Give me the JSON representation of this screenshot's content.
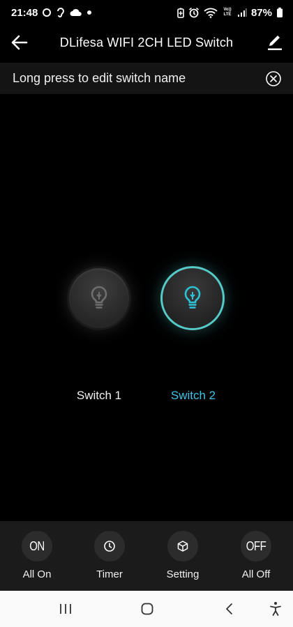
{
  "status_bar": {
    "time": "21:48",
    "battery": "87%",
    "icons_left": [
      "circle-notification-icon",
      "hearing-icon",
      "cloud-icon",
      "dot-icon"
    ],
    "icons_right": [
      "battery-saver-icon",
      "alarm-icon",
      "wifi-icon",
      "volte-icon",
      "signal-icon",
      "battery-icon"
    ],
    "volte_text": "Vo)) LTE"
  },
  "app_bar": {
    "title": "DLifesa WIFI 2CH LED Switch"
  },
  "hint": {
    "text": "Long press to edit switch name"
  },
  "switches": [
    {
      "label": "Switch 1",
      "state": "off"
    },
    {
      "label": "Switch 2",
      "state": "on"
    }
  ],
  "colors": {
    "accent": "#3ec3e6",
    "on_ring": "#57c9c6",
    "on_bulb": "#2ec2d6",
    "off_bulb": "#6e6e6e"
  },
  "actions": {
    "all_on": {
      "icon_text": "ON",
      "label": "All On"
    },
    "timer": {
      "label": "Timer"
    },
    "setting": {
      "label": "Setting"
    },
    "all_off": {
      "icon_text": "OFF",
      "label": "All Off"
    }
  }
}
